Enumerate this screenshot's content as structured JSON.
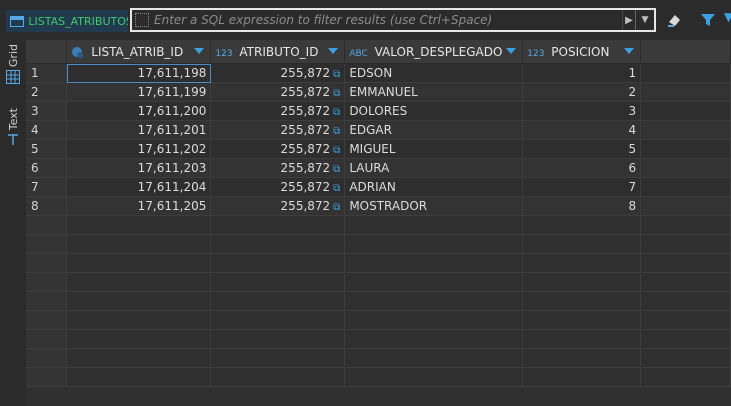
{
  "tab": {
    "label": "LISTAS_ATRIBUTOS"
  },
  "filter": {
    "placeholder": "Enter a SQL expression to filter results (use Ctrl+Space)"
  },
  "sidebar": {
    "grid_label": "Grid",
    "text_label": "Text"
  },
  "columns": [
    {
      "type": "",
      "name": "LISTA_ATRIB_ID"
    },
    {
      "type": "123",
      "name": "ATRIBUTO_ID"
    },
    {
      "type": "ABC",
      "name": "VALOR_DESPLEGADO"
    },
    {
      "type": "123",
      "name": "POSICION"
    }
  ],
  "rows": [
    {
      "n": "1",
      "lista_atrib_id": "17,611,198",
      "atributo_id": "255,872",
      "valor": "EDSON",
      "posicion": "1"
    },
    {
      "n": "2",
      "lista_atrib_id": "17,611,199",
      "atributo_id": "255,872",
      "valor": "EMMANUEL",
      "posicion": "2"
    },
    {
      "n": "3",
      "lista_atrib_id": "17,611,200",
      "atributo_id": "255,872",
      "valor": "DOLORES",
      "posicion": "3"
    },
    {
      "n": "4",
      "lista_atrib_id": "17,611,201",
      "atributo_id": "255,872",
      "valor": "EDGAR",
      "posicion": "4"
    },
    {
      "n": "5",
      "lista_atrib_id": "17,611,202",
      "atributo_id": "255,872",
      "valor": "MIGUEL",
      "posicion": "5"
    },
    {
      "n": "6",
      "lista_atrib_id": "17,611,203",
      "atributo_id": "255,872",
      "valor": "LAURA",
      "posicion": "6"
    },
    {
      "n": "7",
      "lista_atrib_id": "17,611,204",
      "atributo_id": "255,872",
      "valor": "ADRIAN",
      "posicion": "7"
    },
    {
      "n": "8",
      "lista_atrib_id": "17,611,205",
      "atributo_id": "255,872",
      "valor": "MOSTRADOR",
      "posicion": "8"
    }
  ],
  "colors": {
    "accent": "#3b9fe0",
    "tab_text": "#42c96b",
    "selection": "#1a4a72"
  }
}
